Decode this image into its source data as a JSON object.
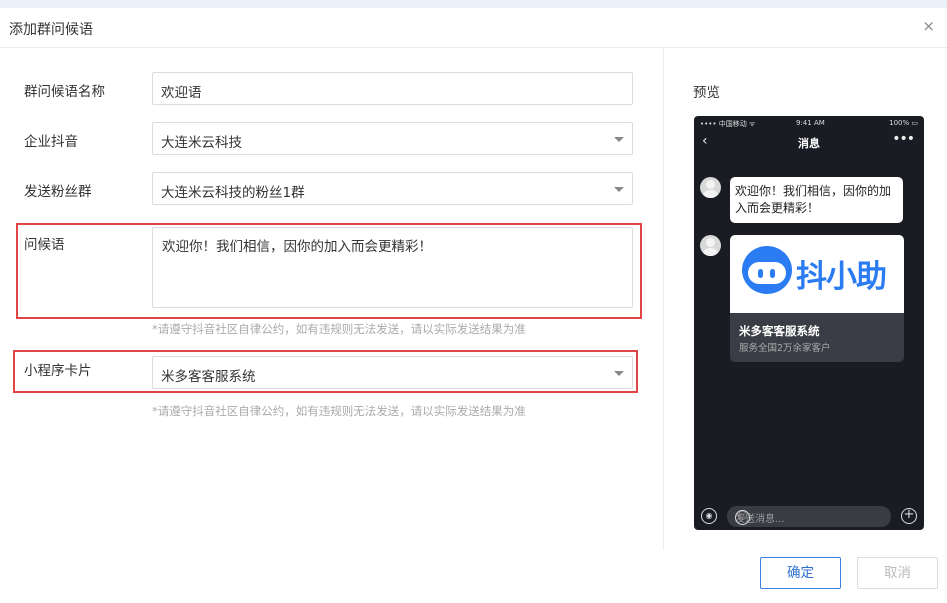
{
  "dialog": {
    "title": "添加群问候语",
    "close_icon": "×"
  },
  "form": {
    "name_label": "群问候语名称",
    "name_value": "欢迎语",
    "account_label": "企业抖音",
    "account_value": "大连米云科技",
    "group_label": "发送粉丝群",
    "group_value": "大连米云科技的粉丝1群",
    "greeting_label": "问候语",
    "greeting_value": "欢迎你！我们相信，因你的加入而会更精彩！",
    "greeting_hint": "*请遵守抖音社区自律公约，如有违规则无法发送，请以实际发送结果为准",
    "miniprogram_label": "小程序卡片",
    "miniprogram_value": "米多客客服系统",
    "miniprogram_hint": "*请遵守抖音社区自律公约，如有违规则无法发送，请以实际发送结果为准",
    "highlight_color": "#e04545"
  },
  "preview": {
    "label": "预览",
    "status": {
      "carrier": "•••• 中国移动 ᯤ",
      "time": "9:41 AM",
      "battery": "100% ▭"
    },
    "nav": {
      "back": "‹",
      "title": "消息",
      "more": "•••"
    },
    "bubble_text": "欢迎你！我们相信，因你的加入而会更精彩！",
    "card": {
      "brand": "抖小助",
      "name": "米多客客服系统",
      "desc": "服务全国2万余家客户",
      "brand_color": "#2b7cf2"
    },
    "input": {
      "placeholder": "发送消息...",
      "voice_icon": "◉",
      "emoji_icon": "☺",
      "plus_icon": "+"
    }
  },
  "buttons": {
    "ok": "确定",
    "cancel": "取消"
  }
}
